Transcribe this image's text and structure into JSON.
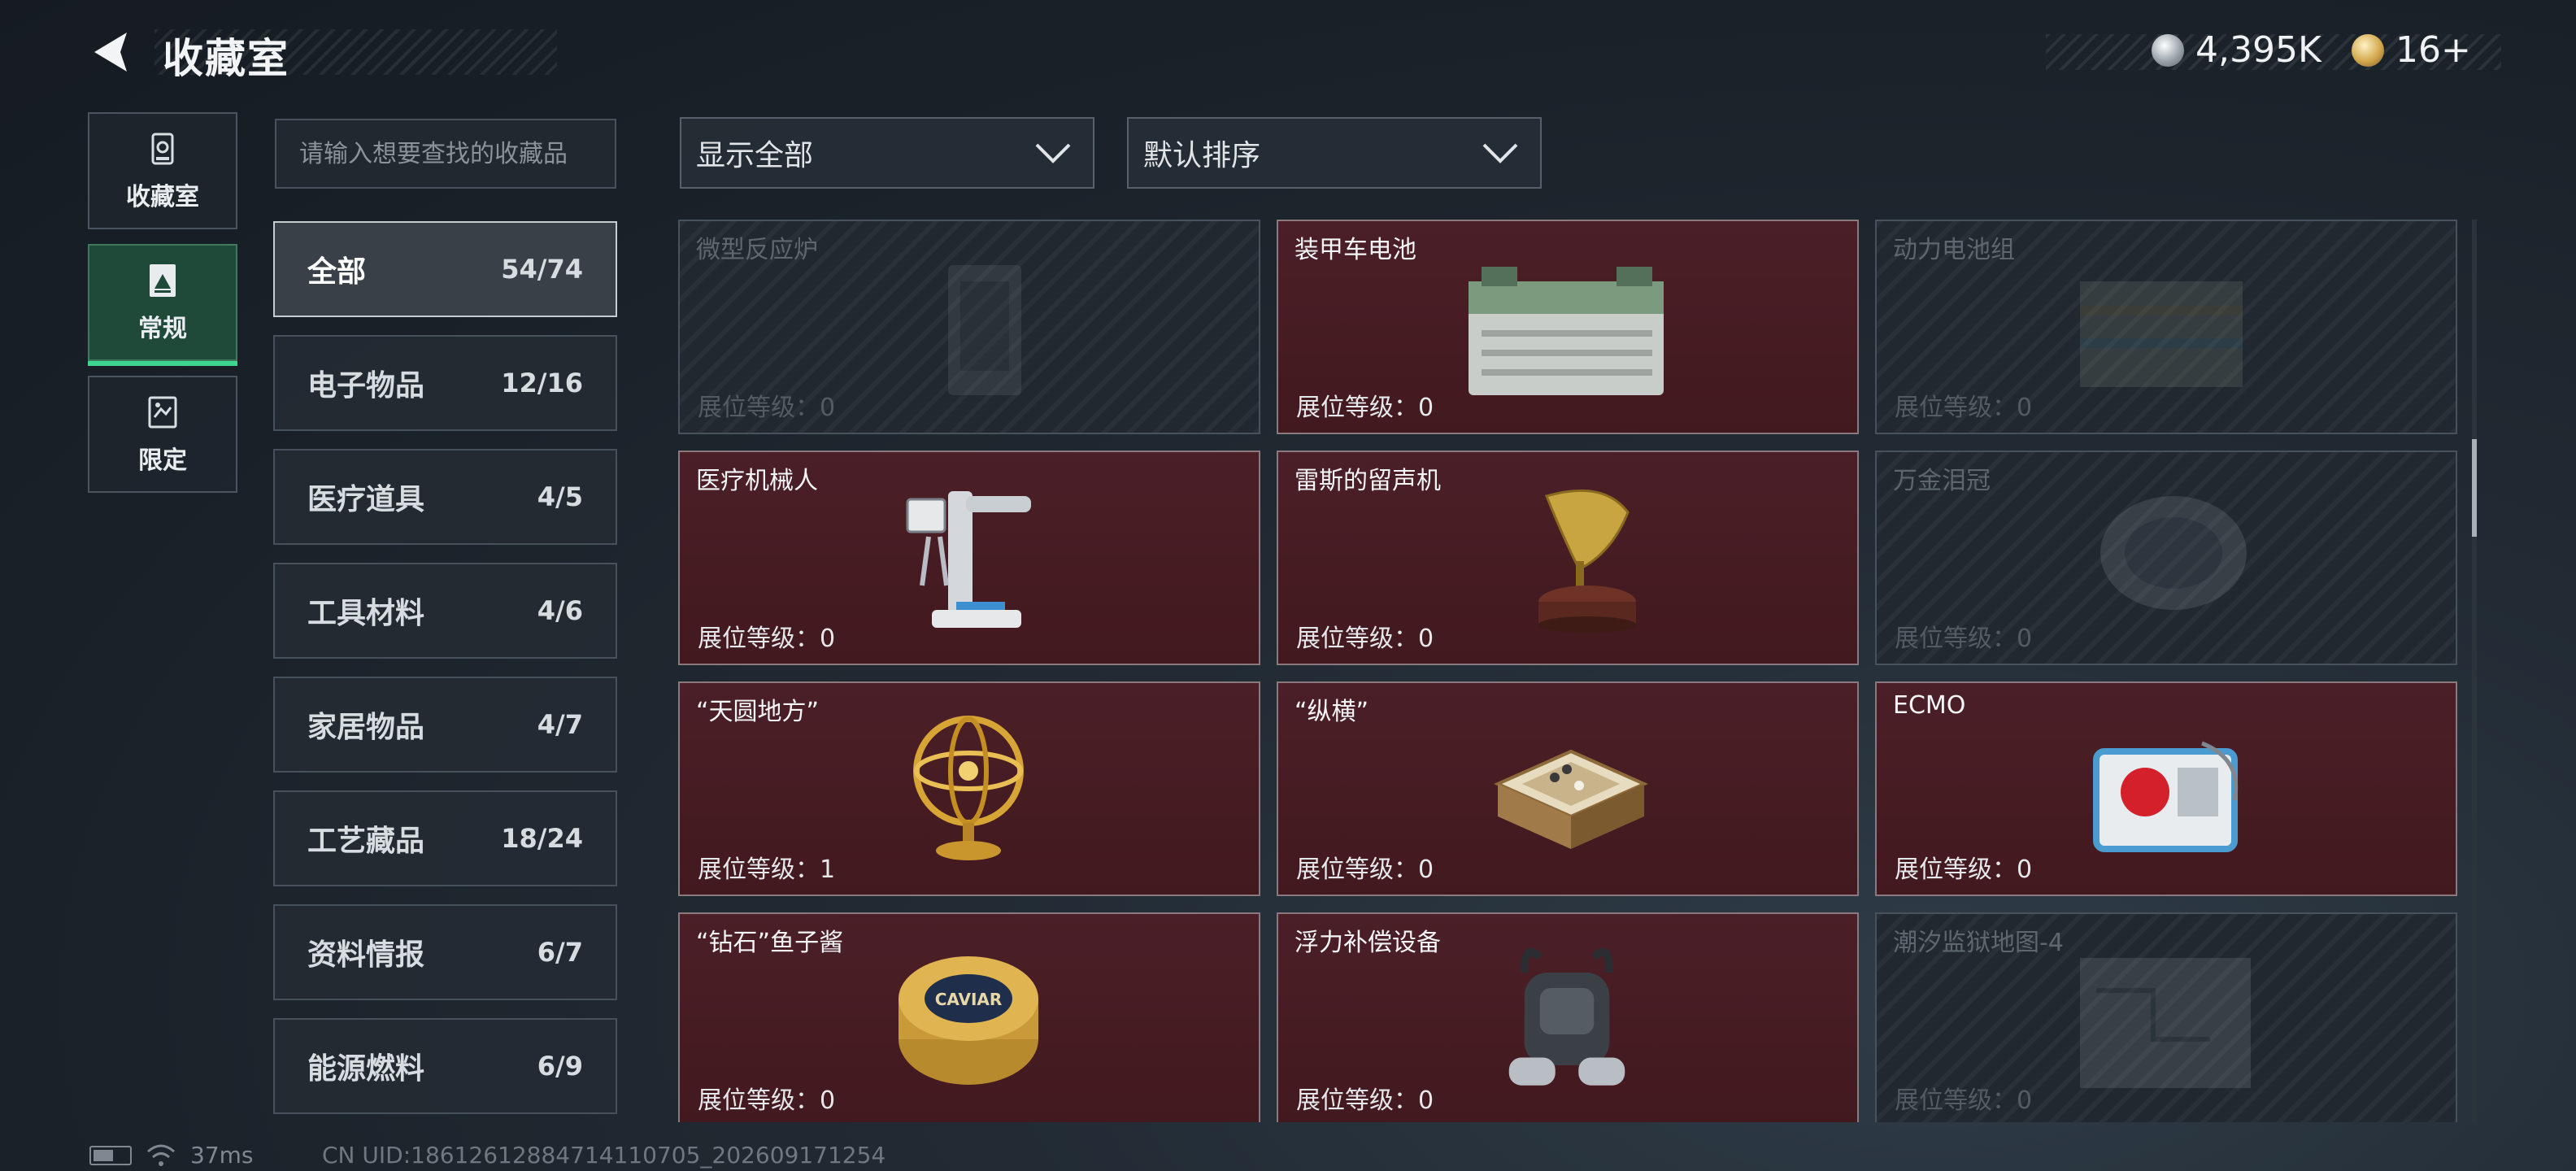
{
  "header": {
    "title": "收藏室",
    "currencies": [
      {
        "icon": "silver-coin-icon",
        "value": "4,395K"
      },
      {
        "icon": "gold-coin-icon",
        "value": "16+"
      }
    ]
  },
  "nav": {
    "items": [
      {
        "label": "收藏室",
        "icon": "collection-room-icon",
        "active": false
      },
      {
        "label": "常规",
        "icon": "regular-icon",
        "active": true
      },
      {
        "label": "限定",
        "icon": "limited-icon",
        "active": false
      }
    ]
  },
  "search": {
    "placeholder": "请输入想要查找的收藏品"
  },
  "categories": [
    {
      "name": "全部",
      "count": "54/74",
      "active": true
    },
    {
      "name": "电子物品",
      "count": "12/16"
    },
    {
      "name": "医疗道具",
      "count": "4/5"
    },
    {
      "name": "工具材料",
      "count": "4/6"
    },
    {
      "name": "家居物品",
      "count": "4/7"
    },
    {
      "name": "工艺藏品",
      "count": "18/24"
    },
    {
      "name": "资料情报",
      "count": "6/7"
    },
    {
      "name": "能源燃料",
      "count": "6/9"
    }
  ],
  "filters": {
    "display": "显示全部",
    "sort": "默认排序"
  },
  "items": [
    {
      "name": "微型反应炉",
      "level": "展位等级：0",
      "owned": false,
      "icon": "micro-reactor-icon"
    },
    {
      "name": "装甲车电池",
      "level": "展位等级：0",
      "owned": true,
      "icon": "armored-vehicle-battery-icon"
    },
    {
      "name": "动力电池组",
      "level": "展位等级：0",
      "owned": false,
      "icon": "power-battery-pack-icon"
    },
    {
      "name": "医疗机械人",
      "level": "展位等级：0",
      "owned": true,
      "icon": "medical-robot-icon"
    },
    {
      "name": "雷斯的留声机",
      "level": "展位等级：0",
      "owned": true,
      "icon": "gramophone-icon"
    },
    {
      "name": "万金泪冠",
      "level": "展位等级：0",
      "owned": false,
      "icon": "crown-icon"
    },
    {
      "name": "“天圆地方”",
      "level": "展位等级：1",
      "owned": true,
      "icon": "armillary-sphere-icon"
    },
    {
      "name": "“纵横”",
      "level": "展位等级：0",
      "owned": true,
      "icon": "chess-board-icon"
    },
    {
      "name": "ECMO",
      "level": "展位等级：0",
      "owned": true,
      "icon": "ecmo-machine-icon"
    },
    {
      "name": "“钻石”鱼子酱",
      "level": "展位等级：0",
      "owned": true,
      "icon": "caviar-tin-icon"
    },
    {
      "name": "浮力补偿设备",
      "level": "展位等级：0",
      "owned": true,
      "icon": "buoyancy-compensator-icon"
    },
    {
      "name": "潮汐监狱地图-4",
      "level": "展位等级：0",
      "owned": false,
      "icon": "map-icon"
    }
  ],
  "caviar_label": "CAVIAR",
  "status": {
    "ping": "37ms",
    "uid": "CN UID:18612612884714110705_202609171254"
  },
  "colors": {
    "owned_card": "#4b1f27",
    "active_nav": "#1f4a3a",
    "accent_green": "#3fd68f"
  }
}
